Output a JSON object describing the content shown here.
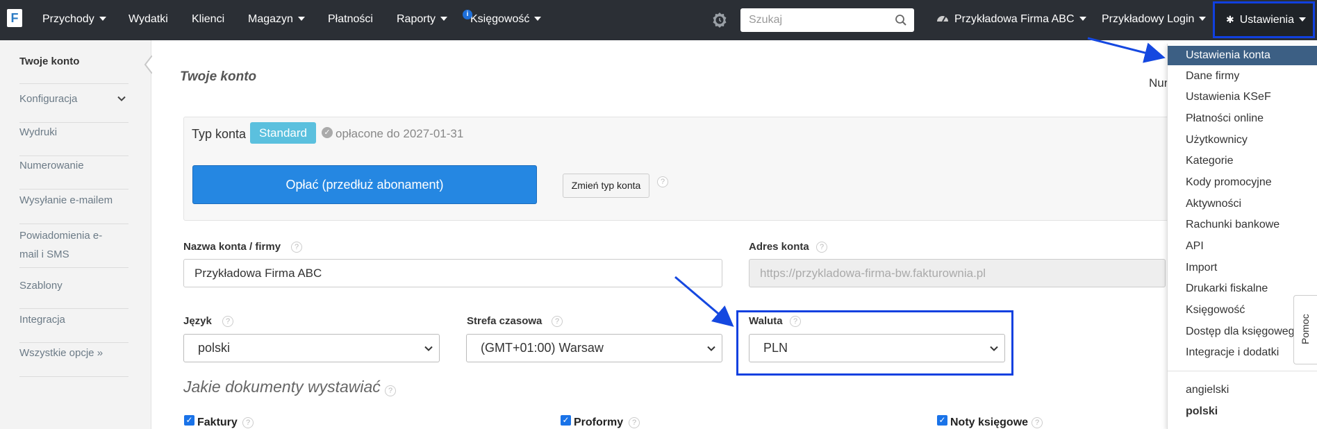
{
  "navbar": {
    "logo": "F",
    "items": [
      {
        "label": "Przychody",
        "caret": true
      },
      {
        "label": "Wydatki",
        "caret": false
      },
      {
        "label": "Klienci",
        "caret": false
      },
      {
        "label": "Magazyn",
        "caret": true
      },
      {
        "label": "Płatności",
        "caret": false
      },
      {
        "label": "Raporty",
        "caret": true
      },
      {
        "label": "Księgowość",
        "caret": true
      }
    ],
    "info_badge": "i",
    "search_placeholder": "Szukaj",
    "company": "Przykładowa Firma ABC",
    "login": "Przykładowy Login",
    "settings": "Ustawienia"
  },
  "sidebar": {
    "items": [
      "Twoje konto",
      "Konfiguracja",
      "Wydruki",
      "Numerowanie",
      "Wysyłanie e-mailem",
      "Powiadomienia e-mail i SMS",
      "Szablony",
      "Integracja",
      "Wszystkie opcje »"
    ]
  },
  "main": {
    "title": "Twoje konto",
    "partial_text": "Nur",
    "plan": {
      "label": "Typ konta",
      "badge": "Standard",
      "paid_until": "opłacone do 2027-01-31",
      "pay_button": "Opłać (przedłuż abonament)",
      "change_button": "Zmień typ konta"
    },
    "account_name": {
      "label": "Nazwa konta / firmy",
      "value": "Przykładowa Firma ABC"
    },
    "account_address": {
      "label": "Adres konta",
      "value": "https://przykladowa-firma-bw.fakturownia.pl"
    },
    "language": {
      "label": "Język",
      "value": "polski"
    },
    "timezone": {
      "label": "Strefa czasowa",
      "value": "(GMT+01:00) Warsaw"
    },
    "currency": {
      "label": "Waluta",
      "value": "PLN"
    },
    "documents_title": "Jakie dokumenty wystawiać",
    "documents": [
      {
        "label": "Faktury",
        "checked": true
      },
      {
        "label": "Proformy",
        "checked": true
      },
      {
        "label": "Noty księgowe",
        "checked": true
      }
    ],
    "help_glyph": "?"
  },
  "dropdown": {
    "items": [
      "Ustawienia konta",
      "Dane firmy",
      "Ustawienia KSeF",
      "Płatności online",
      "Użytkownicy",
      "Kategorie",
      "Kody promocyjne",
      "Aktywności",
      "Rachunki bankowe",
      "API",
      "Import",
      "Drukarki fiskalne",
      "Księgowość",
      "Dostęp dla księgowego",
      "Integracje i dodatki"
    ],
    "languages": [
      "angielski",
      "polski"
    ],
    "active_item": "Ustawienia konta",
    "active_language": "polski"
  },
  "help_tab": "Pomoc",
  "colors": {
    "navbar_bg": "#2b2f35",
    "accent_blue": "#2587e2",
    "badge_cyan": "#5bc0de",
    "highlight_frame": "#1040e0",
    "menu_active": "#3c5f84"
  }
}
